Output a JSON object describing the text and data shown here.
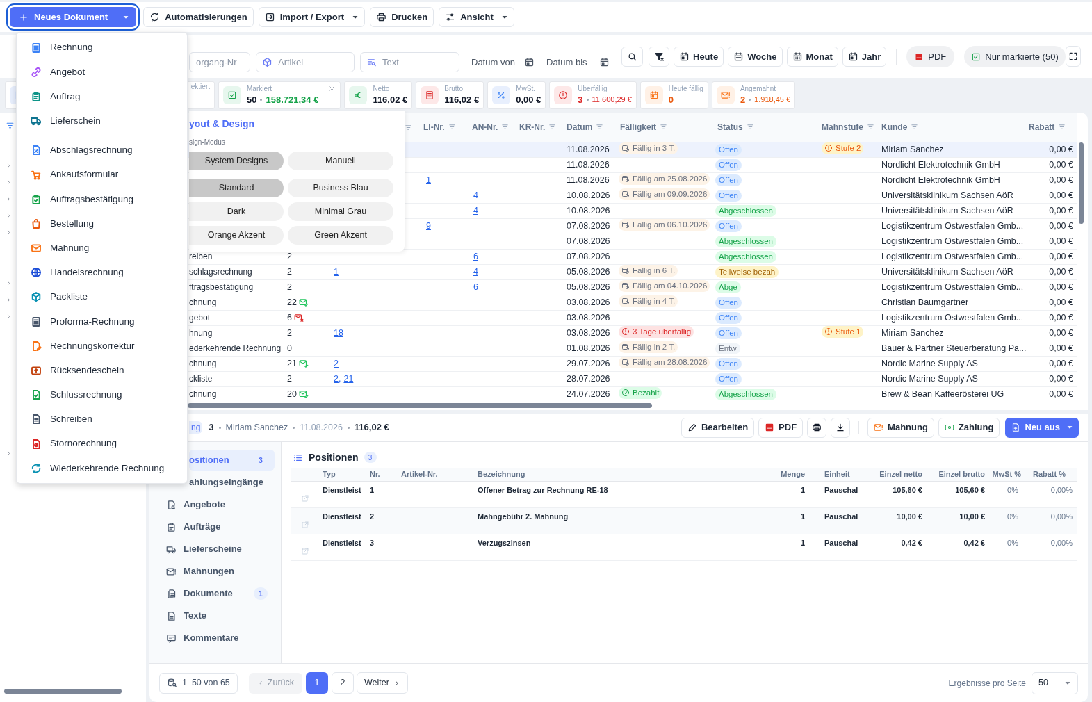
{
  "toolbar": {
    "new_document": "Neues Dokument",
    "buttons": [
      {
        "label": "Automatisierungen",
        "kind": "plain"
      },
      {
        "label": "Import / Export",
        "kind": "menu"
      },
      {
        "label": "Drucken",
        "kind": "plain"
      },
      {
        "label": "Ansicht",
        "kind": "menu"
      }
    ]
  },
  "filters": {
    "fields": [
      {
        "placeholder": "organg-Nr"
      },
      {
        "placeholder": "Artikel"
      },
      {
        "placeholder": "Text"
      }
    ],
    "date_from": {
      "placeholder": "Datum von"
    },
    "date_to": {
      "placeholder": "Datum bis"
    },
    "periods": [
      "Heute",
      "Woche",
      "Monat",
      "Jahr"
    ],
    "pdf": "PDF",
    "only_marked": {
      "label": "Nur markierte (50)",
      "on": true
    }
  },
  "stats": [
    {
      "kind": "selected",
      "label": "lektiert"
    },
    {
      "kind": "marked",
      "label": "Markiert",
      "value": "50",
      "amount": "158.721,34 €"
    },
    {
      "kind": "net",
      "label": "Netto",
      "value": "116,02 €"
    },
    {
      "kind": "gross",
      "label": "Brutto",
      "value": "116,02 €"
    },
    {
      "kind": "vat",
      "label": "MwSt.",
      "value": "0,00 €"
    },
    {
      "kind": "overdue",
      "label": "Überfällig",
      "value": "3",
      "amount": "11.600,29 €"
    },
    {
      "kind": "due_today",
      "label": "Heute fällig",
      "value": "0"
    },
    {
      "kind": "dunned",
      "label": "Angemahnt",
      "value": "2",
      "amount": "1.918,45 €"
    }
  ],
  "sidebar": {
    "tree": [
      {
        "expanded": false
      },
      {
        "expanded": false
      },
      {
        "expanded": false
      },
      {
        "expanded": false
      },
      {
        "expanded": false
      },
      {
        "expanded": false
      },
      {
        "expanded": false
      },
      {
        "expanded": false
      },
      {
        "expanded": false
      }
    ]
  },
  "table": {
    "columns": [
      "LI-Nr.",
      "AN-Nr.",
      "KR-Nr.",
      "Datum",
      "Fälligkeit",
      "Status",
      "Mahnstufe",
      "Kunde",
      "Rabatt"
    ],
    "rows": [
      {
        "selected": true,
        "date": "11.08.2026",
        "due": {
          "text": "Fällig in 3 T.",
          "kind": "due"
        },
        "status": {
          "text": "Offen",
          "kind": "open"
        },
        "dunning": "Stufe 2",
        "customer": "Miriam Sanchez",
        "discount": "0,00 €"
      },
      {
        "selected": false,
        "date": "11.08.2026",
        "status": {
          "text": "Offen",
          "kind": "open"
        },
        "customer": "Nordlicht Elektrotechnik GmbH",
        "discount": "0,00 €"
      },
      {
        "selected": false,
        "li": "1",
        "date": "11.08.2026",
        "due": {
          "text": "Fällig am 25.08.2026",
          "kind": "due"
        },
        "status": {
          "text": "Offen",
          "kind": "open"
        },
        "customer": "Nordlicht Elektrotechnik GmbH",
        "discount": "0,00 €"
      },
      {
        "selected": false,
        "an": "4",
        "date": "10.08.2026",
        "due": {
          "text": "Fällig am 09.09.2026",
          "kind": "due"
        },
        "status": {
          "text": "Offen",
          "kind": "open"
        },
        "customer": "Universitätsklinikum Sachsen AöR",
        "discount": "0,00 €"
      },
      {
        "selected": false,
        "an": "4",
        "date": "10.08.2026",
        "status": {
          "text": "Abgeschlossen",
          "kind": "closed"
        },
        "customer": "Universitätsklinikum Sachsen AöR",
        "discount": "0,00 €"
      },
      {
        "selected": false,
        "li": "9",
        "date": "07.08.2026",
        "due": {
          "text": "Fällig am 06.10.2026",
          "kind": "due"
        },
        "status": {
          "text": "Offen",
          "kind": "open"
        },
        "customer": "Logistikzentrum Ostwestfalen Gmb...",
        "discount": "0,00 €"
      },
      {
        "selected": false,
        "date": "07.08.2026",
        "status": {
          "text": "Abgeschlossen",
          "kind": "closed"
        },
        "customer": "Logistikzentrum Ostwestfalen Gmb...",
        "discount": "0,00 €"
      },
      {
        "selected": false,
        "column_1": "reiben",
        "column_2": "2",
        "an": "6",
        "date": "07.08.2026",
        "status": {
          "text": "Abgeschlossen",
          "kind": "closed"
        },
        "customer": "Logistikzentrum Ostwestfalen Gmb...",
        "discount": "0,00 €"
      },
      {
        "selected": false,
        "column_1": "schlagsrechnung",
        "column_2": "2",
        "column_3": [
          "1"
        ],
        "an": "4",
        "date": "05.08.2026",
        "due": {
          "text": "Fällig in 6 T.",
          "kind": "due"
        },
        "status": {
          "text": "Teilweise bezah",
          "kind": "partial"
        },
        "customer": "Universitätsklinikum Sachsen AöR",
        "discount": "0,00 €"
      },
      {
        "selected": false,
        "column_1": "ftragsbestätigung",
        "column_2": "2",
        "an": "6",
        "date": "05.08.2026",
        "due": {
          "text": "Fällig am 04.10.2026",
          "kind": "due"
        },
        "status": {
          "text": "Abge",
          "kind": "closed"
        },
        "customer": "Logistikzentrum Ostwestfalen Gmb...",
        "discount": "0,00 €"
      },
      {
        "selected": false,
        "column_1": "chnung",
        "column_2": "22",
        "mail_sent": true,
        "date": "03.08.2026",
        "due": {
          "text": "Fällig in 4 T.",
          "kind": "due"
        },
        "status": {
          "text": "Offen",
          "kind": "open"
        },
        "customer": "Christian Baumgartner",
        "discount": "0,00 €"
      },
      {
        "selected": false,
        "column_1": "gebot",
        "column_2": "6",
        "mail_failed": true,
        "date": "03.08.2026",
        "status": {
          "text": "Offen",
          "kind": "open"
        },
        "customer": "Logistikzentrum Ostwestfalen Gmb...",
        "discount": "0,00 €"
      },
      {
        "selected": false,
        "column_1": "hnung",
        "column_2": "2",
        "column_3": [
          "18"
        ],
        "date": "03.08.2026",
        "due": {
          "text": "3 Tage überfällig",
          "kind": "overdue"
        },
        "status": {
          "text": "Offen",
          "kind": "open"
        },
        "dunning": "Stufe 1",
        "customer": "Miriam Sanchez",
        "discount": "0,00 €"
      },
      {
        "selected": false,
        "column_1": "ederkehrende Rechnung",
        "column_2": "0",
        "date": "01.08.2026",
        "due": {
          "text": "Fällig in 2 T.",
          "kind": "due"
        },
        "status": {
          "text": "Entw",
          "kind": "draft"
        },
        "customer": "Bauer & Partner Steuerberatung Pa...",
        "discount": "0,00 €"
      },
      {
        "selected": false,
        "column_1": "chnung",
        "column_2": "21",
        "mail_sent": true,
        "column_3": [
          "2"
        ],
        "date": "29.07.2026",
        "due": {
          "text": "Fällig am 28.08.2026",
          "kind": "due"
        },
        "status": {
          "text": "Offen",
          "kind": "open"
        },
        "customer": "Nordic Marine Supply AS",
        "discount": "0,00 €"
      },
      {
        "selected": false,
        "column_1": "ckliste",
        "column_2": "2",
        "column_3": [
          "2,",
          "21"
        ],
        "date": "28.07.2026",
        "status": {
          "text": "Offen",
          "kind": "open"
        },
        "customer": "Nordic Marine Supply AS",
        "discount": "0,00 €"
      },
      {
        "selected": false,
        "column_1": "chnung",
        "column_2": "20",
        "mail_sent": true,
        "date": "24.07.2026",
        "due": {
          "text": "Bezahlt",
          "kind": "paid"
        },
        "status": {
          "text": "Abgeschlossen",
          "kind": "closed"
        },
        "customer": "Brew & Bean Kaffeerösterei UG",
        "discount": "0,00 €"
      }
    ]
  },
  "design_popover": {
    "title": "yout & Design",
    "mode_label": "sign-Modus",
    "modes": [
      {
        "label": "System Designs",
        "selected": true
      },
      {
        "label": "Manuell",
        "selected": false
      }
    ],
    "themes": [
      {
        "label": "Standard",
        "selected": true
      },
      {
        "label": "Business Blau",
        "selected": false
      },
      {
        "label": "Dark",
        "selected": false
      },
      {
        "label": "Minimal Grau",
        "selected": false
      },
      {
        "label": "Orange Akzent",
        "selected": false
      },
      {
        "label": "Green Akzent",
        "selected": false
      }
    ]
  },
  "new_menu": {
    "groups": [
      [
        {
          "label": "Rechnung",
          "color": "#3b82f6"
        },
        {
          "label": "Angebot",
          "color": "#a855f7"
        },
        {
          "label": "Auftrag",
          "color": "#0d9488"
        },
        {
          "label": "Lieferschein",
          "color": "#0e7490"
        }
      ],
      [
        {
          "label": "Abschlagsrechnung",
          "color": "#3b82f6"
        },
        {
          "label": "Ankaufsformular",
          "color": "#f97316"
        },
        {
          "label": "Auftragsbestätigung",
          "color": "#16a34a"
        },
        {
          "label": "Bestellung",
          "color": "#ea580c"
        },
        {
          "label": "Mahnung",
          "color": "#f97316"
        },
        {
          "label": "Handelsrechnung",
          "color": "#1d4ed8"
        },
        {
          "label": "Packliste",
          "color": "#0891b2"
        },
        {
          "label": "Proforma-Rechnung",
          "color": "#475569"
        },
        {
          "label": "Rechnungskorrektur",
          "color": "#f97316"
        },
        {
          "label": "Rücksendeschein",
          "color": "#c2410c"
        },
        {
          "label": "Schlussrechnung",
          "color": "#16a34a"
        },
        {
          "label": "Schreiben",
          "color": "#475569"
        },
        {
          "label": "Stornorechnung",
          "color": "#dc2626"
        },
        {
          "label": "Wiederkehrende Rechnung",
          "color": "#0891b2"
        }
      ]
    ]
  },
  "detail": {
    "badge": "ng",
    "number": "3",
    "customer": "Miriam Sanchez",
    "date": "11.08.2026",
    "total": "116,02 €",
    "actions": [
      {
        "kind": "edit",
        "label": "Bearbeiten"
      },
      {
        "kind": "pdf",
        "label": "PDF"
      },
      {
        "kind": "print"
      },
      {
        "kind": "download"
      },
      {
        "kind": "dunning",
        "label": "Mahnung"
      },
      {
        "kind": "payment",
        "label": "Zahlung"
      },
      {
        "kind": "new_from",
        "label": "Neu aus"
      }
    ],
    "tabs": [
      {
        "label": "ositionen",
        "count": "3",
        "selected": true
      },
      {
        "label": "ahlungseingänge",
        "selected": false
      },
      {
        "label": "Angebote",
        "selected": false
      },
      {
        "label": "Aufträge",
        "selected": false
      },
      {
        "label": "Lieferscheine",
        "selected": false
      },
      {
        "label": "Mahnungen",
        "selected": false
      },
      {
        "label": "Dokumente",
        "count": "1",
        "selected": false
      },
      {
        "label": "Texte",
        "selected": false
      },
      {
        "label": "Kommentare",
        "selected": false
      }
    ],
    "positions": {
      "title": "Positionen",
      "count": "3",
      "columns": [
        "Typ",
        "Nr.",
        "Artikel-Nr.",
        "Bezeichnung",
        "Menge",
        "Einheit",
        "Einzel netto",
        "Einzel brutto",
        "MwSt %",
        "Rabatt %"
      ],
      "rows": [
        {
          "type": "Dienstleist",
          "nr": "1",
          "description": "Offener Betrag zur Rechnung RE-18",
          "qty": "1",
          "unit": "Pauschal",
          "net": "105,60 €",
          "gross": "105,60 €",
          "vat": "0%",
          "discount": "0,00%"
        },
        {
          "type": "Dienstleist",
          "nr": "2",
          "description": "Mahngebühr 2. Mahnung",
          "qty": "1",
          "unit": "Pauschal",
          "net": "10,00 €",
          "gross": "10,00 €",
          "vat": "0%",
          "discount": "0,00%"
        },
        {
          "type": "Dienstleist",
          "nr": "3",
          "description": "Verzugszinsen",
          "qty": "1",
          "unit": "Pauschal",
          "net": "0,42 €",
          "gross": "0,42 €",
          "vat": "0%",
          "discount": "0,00%"
        }
      ]
    }
  },
  "pagination": {
    "range": "1–50 von 65",
    "prev": {
      "label": "Zurück",
      "disabled": true
    },
    "pages": [
      {
        "label": "1",
        "selected": true
      },
      {
        "label": "2",
        "selected": false
      }
    ],
    "next": "Weiter",
    "per_page_label": "Ergebnisse pro Seite",
    "per_page": "50"
  }
}
